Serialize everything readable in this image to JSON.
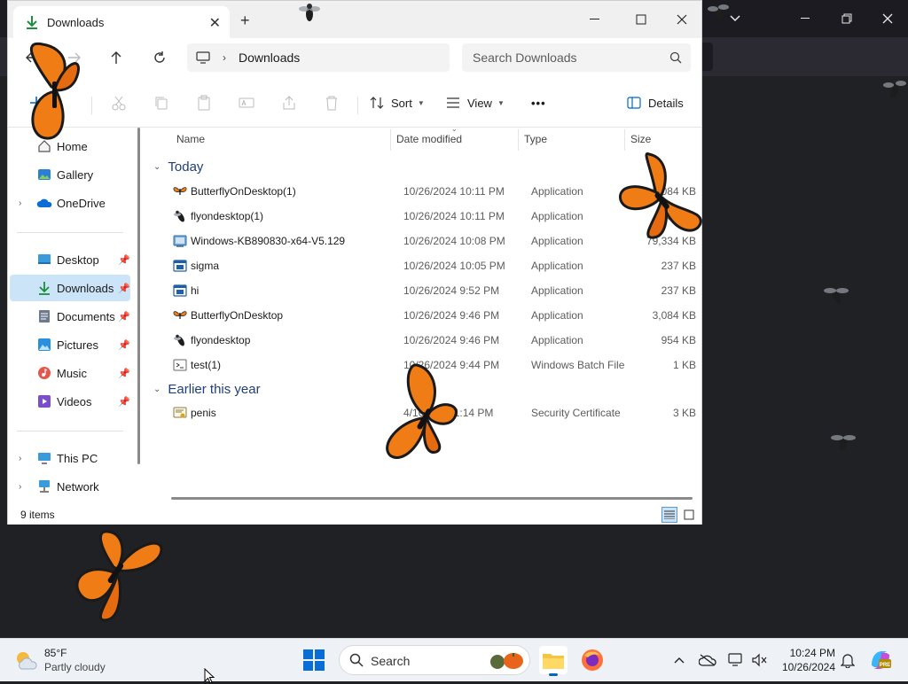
{
  "explorer": {
    "tab_title": "Downloads",
    "breadcrumb": "Downloads",
    "search_placeholder": "Search Downloads",
    "commands": {
      "sort": "Sort",
      "view": "View",
      "more": "•••",
      "details": "Details"
    },
    "columns": {
      "name": "Name",
      "date": "Date modified",
      "type": "Type",
      "size": "Size"
    },
    "groups": {
      "today": "Today",
      "earlier": "Earlier this year"
    },
    "files": [
      {
        "name": "ButterflyOnDesktop(1)",
        "date": "10/26/2024 10:11 PM",
        "type": "Application",
        "size": "3,084 KB",
        "icon": "butterfly-icon"
      },
      {
        "name": "flyondesktop(1)",
        "date": "10/26/2024 10:11 PM",
        "type": "Application",
        "size": "954 KB",
        "icon": "fly-icon"
      },
      {
        "name": "Windows-KB890830-x64-V5.129",
        "date": "10/26/2024 10:08 PM",
        "type": "Application",
        "size": "79,334 KB",
        "icon": "installer-icon"
      },
      {
        "name": "sigma",
        "date": "10/26/2024 10:05 PM",
        "type": "Application",
        "size": "237 KB",
        "icon": "app-window-icon"
      },
      {
        "name": "hi",
        "date": "10/26/2024 9:52 PM",
        "type": "Application",
        "size": "237 KB",
        "icon": "app-window-icon"
      },
      {
        "name": "ButterflyOnDesktop",
        "date": "10/26/2024 9:46 PM",
        "type": "Application",
        "size": "3,084 KB",
        "icon": "butterfly-icon"
      },
      {
        "name": "flyondesktop",
        "date": "10/26/2024 9:46 PM",
        "type": "Application",
        "size": "954 KB",
        "icon": "fly-icon"
      },
      {
        "name": "test(1)",
        "date": "10/26/2024 9:44 PM",
        "type": "Windows Batch File",
        "size": "1 KB",
        "icon": "batch-file-icon"
      }
    ],
    "earlier_files": [
      {
        "name": "penis",
        "date": "4/16/2024 1:14 PM",
        "type": "Security Certificate",
        "size": "3 KB",
        "icon": "certificate-icon"
      }
    ],
    "sidebar": {
      "home": "Home",
      "gallery": "Gallery",
      "onedrive": "OneDrive",
      "desktop": "Desktop",
      "downloads": "Downloads",
      "documents": "Documents",
      "pictures": "Pictures",
      "music": "Music",
      "videos": "Videos",
      "this_pc": "This PC",
      "network": "Network"
    },
    "status": {
      "item_count": "9 items"
    }
  },
  "taskbar": {
    "weather_temp": "85°F",
    "weather_cond": "Partly cloudy",
    "search_label": "Search",
    "time": "10:24 PM",
    "date": "10/26/2024"
  },
  "colors": {
    "accent": "#0067c0",
    "selection": "#cce4f7",
    "group_header": "#1f3f7a",
    "monarch": "#f07c16"
  }
}
